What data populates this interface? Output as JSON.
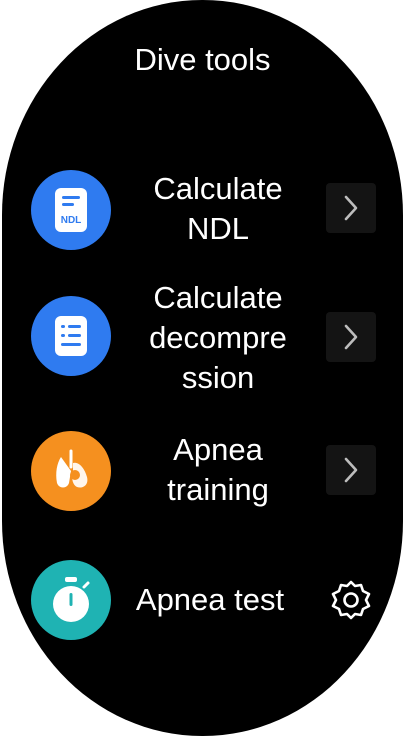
{
  "header": {
    "title": "Dive tools"
  },
  "menu": {
    "items": [
      {
        "lines": [
          "Calculate",
          "NDL"
        ],
        "icon": "ndl-document-icon",
        "icon_text": "NDL",
        "icon_color": "#2f7bf0",
        "action": "chevron-right-icon"
      },
      {
        "lines": [
          "Calculate",
          "decompre",
          "ssion"
        ],
        "icon": "decompression-list-icon",
        "icon_color": "#2f7bf0",
        "action": "chevron-right-icon"
      },
      {
        "lines": [
          "Apnea",
          "training"
        ],
        "icon": "apnea-lungs-icon",
        "icon_color": "#f5901f",
        "action": "chevron-right-icon"
      },
      {
        "lines": [
          "Apnea test"
        ],
        "icon": "stopwatch-icon",
        "icon_color": "#1fb3b3",
        "action": "gear-icon"
      }
    ]
  }
}
